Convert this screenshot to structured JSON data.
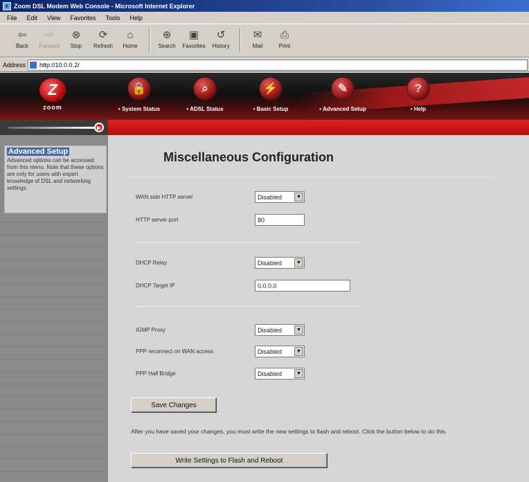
{
  "window": {
    "title": "Zoom DSL Modem Web Console - Microsoft Internet Explorer"
  },
  "menu": [
    "File",
    "Edit",
    "View",
    "Favorites",
    "Tools",
    "Help"
  ],
  "toolbar": [
    {
      "label": "Back",
      "icon": "back-arrow-icon",
      "glyph": "⇦",
      "disabled": false
    },
    {
      "label": "Forward",
      "icon": "forward-arrow-icon",
      "glyph": "⇨",
      "disabled": true
    },
    {
      "label": "Stop",
      "icon": "stop-icon",
      "glyph": "⊗",
      "disabled": false
    },
    {
      "label": "Refresh",
      "icon": "refresh-icon",
      "glyph": "⟳",
      "disabled": false
    },
    {
      "label": "Home",
      "icon": "home-icon",
      "glyph": "⌂",
      "disabled": false
    },
    {
      "label": "Search",
      "icon": "search-icon",
      "glyph": "⊕",
      "disabled": false
    },
    {
      "label": "Favorites",
      "icon": "favorites-icon",
      "glyph": "▣",
      "disabled": false
    },
    {
      "label": "History",
      "icon": "history-icon",
      "glyph": "↺",
      "disabled": false
    },
    {
      "label": "Mail",
      "icon": "mail-icon",
      "glyph": "✉",
      "disabled": false
    },
    {
      "label": "Print",
      "icon": "print-icon",
      "glyph": "⎙",
      "disabled": false
    }
  ],
  "address": {
    "label": "Address",
    "url": "http://10.0.0.2/"
  },
  "brand": {
    "logo_text": "zoom",
    "logo_glyph": "Z",
    "accent": "#c81414"
  },
  "nav": [
    {
      "label": "• System Status",
      "icon": "lock-icon",
      "glyph": "🔒"
    },
    {
      "label": "• ADSL Status",
      "icon": "magnifier-icon",
      "glyph": "⌕"
    },
    {
      "label": "• Basic Setup",
      "icon": "plug-icon",
      "glyph": "⚡"
    },
    {
      "label": "• Advanced Setup",
      "icon": "wrench-icon",
      "glyph": "✎"
    },
    {
      "label": "• Help",
      "icon": "help-icon",
      "glyph": "?"
    }
  ],
  "sidebar": {
    "heading": "Advanced Setup",
    "text": "Advanced options can be accessed from this menu. Note that these options are only for users with expert knowledge of DSL and networking settings."
  },
  "page": {
    "title": "Miscellaneous Configuration",
    "fields": {
      "wan_http_server": {
        "label": "WAN side HTTP server",
        "value": "Disabled"
      },
      "http_server_port": {
        "label": "HTTP server port",
        "value": "80"
      },
      "dhcp_relay": {
        "label": "DHCP Relay",
        "value": "Disabled"
      },
      "dhcp_target_ip": {
        "label": "DHCP Target IP",
        "value": "0.0.0.0"
      },
      "igmp_proxy": {
        "label": "IGMP Proxy",
        "value": "Disabled"
      },
      "ppp_reconnect": {
        "label": "PPP reconnect on WAN access",
        "value": "Disabled"
      },
      "ppp_half_bridge": {
        "label": "PPP Half Bridge",
        "value": "Disabled"
      }
    },
    "save_button": "Save Changes",
    "note": "After you have saved your changes, you must write the new settings to flash and reboot. Click the button below to do this.",
    "write_button": "Write Settings to Flash and Reboot"
  }
}
